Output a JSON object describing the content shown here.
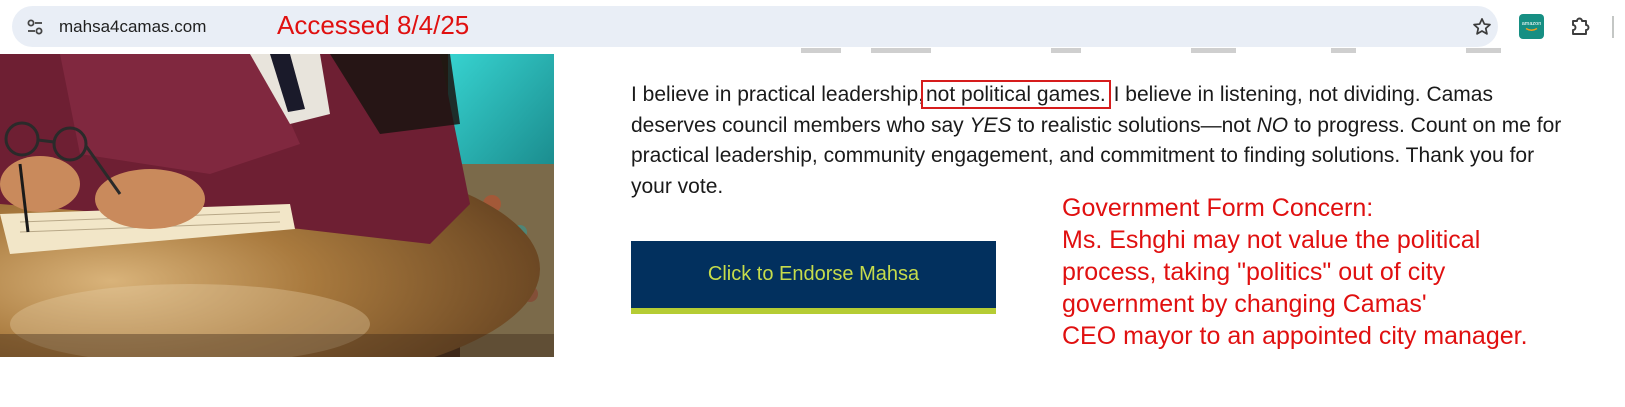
{
  "browser": {
    "url": "mahsa4camas.com",
    "icons": {
      "site_info": "tune-icon",
      "bookmark": "star-icon",
      "extension_amazon": "amazon-extension-icon",
      "extensions": "puzzle-icon"
    },
    "amazon_extension_label": "amazon"
  },
  "annotation": {
    "accessed": "Accessed 8/4/25",
    "color": "#e01010",
    "concern_lines": [
      "Government Form Concern:",
      "Ms. Eshghi may not value the political",
      "process, taking \"politics\" out of city",
      "government by changing Camas'",
      "CEO mayor to an appointed city manager."
    ]
  },
  "content": {
    "paragraph": {
      "part1": "I believe in practical leadership,",
      "highlighted": "not political games.",
      "part2": " I believe in listening, not dividing. Camas deserves council members who say ",
      "yes": "YES",
      "part3": " to realistic solutions—not ",
      "no": "NO",
      "part4": " to progress. Count on me for practical leadership, community engagement, and commitment to finding solutions. Thank you for your vote."
    },
    "endorse_button": "Click to Endorse Mahsa",
    "colors": {
      "button_bg": "#02305e",
      "button_text": "#c6dc4b",
      "button_accent": "#b5cc34",
      "highlight_box": "#d61c1c"
    }
  }
}
